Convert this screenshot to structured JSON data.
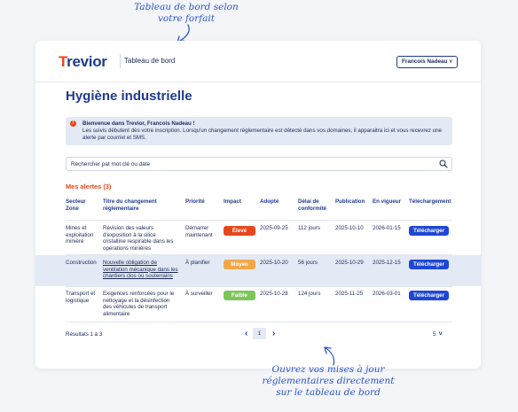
{
  "annotations": {
    "top": [
      "Tableau de bord selon",
      "votre forfait"
    ],
    "bottom": [
      "Ouvrez vos mises à jour",
      "réglementaires directement",
      "sur le tableau de bord"
    ]
  },
  "header": {
    "logo_mark": "T",
    "logo_rest": "revior",
    "dashboard_label": "Tableau de bord",
    "user_name": "Francois Nadeau",
    "user_chevron": "˅"
  },
  "page_title": "Hygiène industrielle",
  "alert": {
    "icon": "!",
    "title": "Bienvenue dans Trevior, Francois Nadeau !",
    "message": "Les suivis débutent dès votre inscription. Lorsqu'un changement réglementaire est détecté dans vos domaines, il apparaitra ici et vous recevrez une alerte par courriel et SMS."
  },
  "search": {
    "placeholder": "Rechercher pat mot clé ou date"
  },
  "alerts_section": {
    "title": "Mes alertes (3)",
    "columns": [
      "Secteur Zone",
      "Titre du changement réglementaire",
      "Priorité",
      "Impact",
      "Adopté",
      "Délai de conformité",
      "Publication",
      "En vigueur",
      "Téléchargement"
    ],
    "rows": [
      {
        "sector": "Mines et exploitation minière",
        "title": "Révision des valeurs d'exposition à la silice cristalline respirable dans les opérations minières",
        "priority": "Démarrer maintenant",
        "impact": "Élevé",
        "impact_color": "#e8471d",
        "adopted": "2025-09-25",
        "delay": "112 jours",
        "publication": "2025-10-10",
        "effective": "2026-01-15",
        "download": "Télécharger"
      },
      {
        "sector": "Construction",
        "title": "Nouvelle obligation de ventilation mécanique dans les chantiers clos ou souterrains",
        "priority": "À planifier",
        "impact": "Moyen",
        "impact_color": "#f2a64a",
        "adopted": "2025-10-20",
        "delay": "56 jours",
        "publication": "2025-10-29",
        "effective": "2025-12-15",
        "download": "Télécharger"
      },
      {
        "sector": "Transport et logistique",
        "title": "Exigences renforcées pour le nettoyage et la désinfection des véhicules de transport alimentaire",
        "priority": "À surveiller",
        "impact": "Faible",
        "impact_color": "#7cc55a",
        "adopted": "2025-10-28",
        "delay": "124 jours",
        "publication": "2025-11-25",
        "effective": "2026-03-01",
        "download": "Télécharger"
      }
    ]
  },
  "pagination": {
    "results_text": "Résultats 1 à 3",
    "current_page": "1",
    "prev": "‹",
    "next": "›",
    "per_page": "5",
    "per_page_chevron": "˅"
  },
  "colors": {
    "brand": "#1f3a8f",
    "accent": "#e8471d",
    "button": "#1f47d4",
    "row_highlight": "#e3e9f5"
  },
  "icons": [
    "search-icon",
    "alert-icon",
    "chevron-down-icon",
    "chevron-left-icon",
    "chevron-right-icon",
    "arrow-icon"
  ]
}
